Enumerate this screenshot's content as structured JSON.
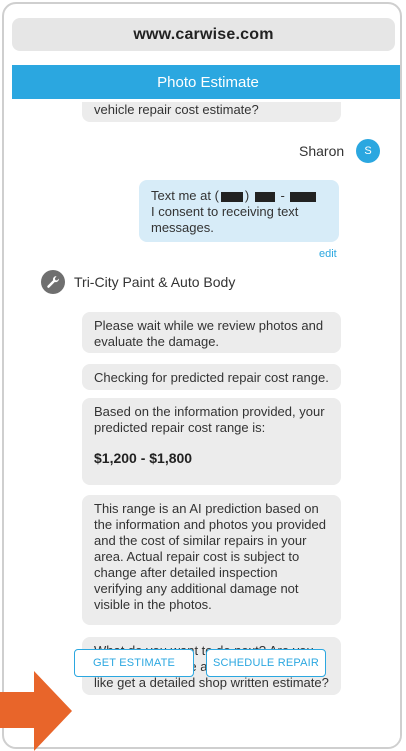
{
  "browser": {
    "url": "www.carwise.com"
  },
  "header": {
    "title": "Photo Estimate"
  },
  "chat": {
    "truncated_message": "vehicle repair cost estimate?",
    "user": {
      "name": "Sharon",
      "initial": "S",
      "message_line1_prefix": "Text me at (",
      "message_line1_mid": ")",
      "message_line1_dash": "-",
      "message_line2": "I consent to receiving text messages.",
      "edit_label": "edit"
    },
    "shop": {
      "name": "Tri-City Paint & Auto Body",
      "messages": [
        "Please wait while we review photos and evaluate the damage.",
        "Checking for predicted repair cost range.",
        "Based on the information provided, your predicted repair cost range is:",
        "This range is an AI prediction based on the information and photos you provided and the cost of similar repairs in your area. Actual repair cost is subject to change after detailed inspection verifying any additional damage not visible in the photos.",
        "What do you want to do next?  Are you ready to schedule a repair or would you like get a detailed shop written estimate?"
      ],
      "price_range": "$1,200 - $1,800"
    },
    "actions": {
      "get_estimate": "GET ESTIMATE",
      "schedule_repair": "SCHEDULE REPAIR"
    }
  },
  "colors": {
    "accent": "#2ba7e0",
    "progress": "#3cc13a",
    "arrow": "#e8652a"
  },
  "icons": {
    "shop_avatar": "wrench-icon",
    "pointer": "arrow-right-icon"
  }
}
